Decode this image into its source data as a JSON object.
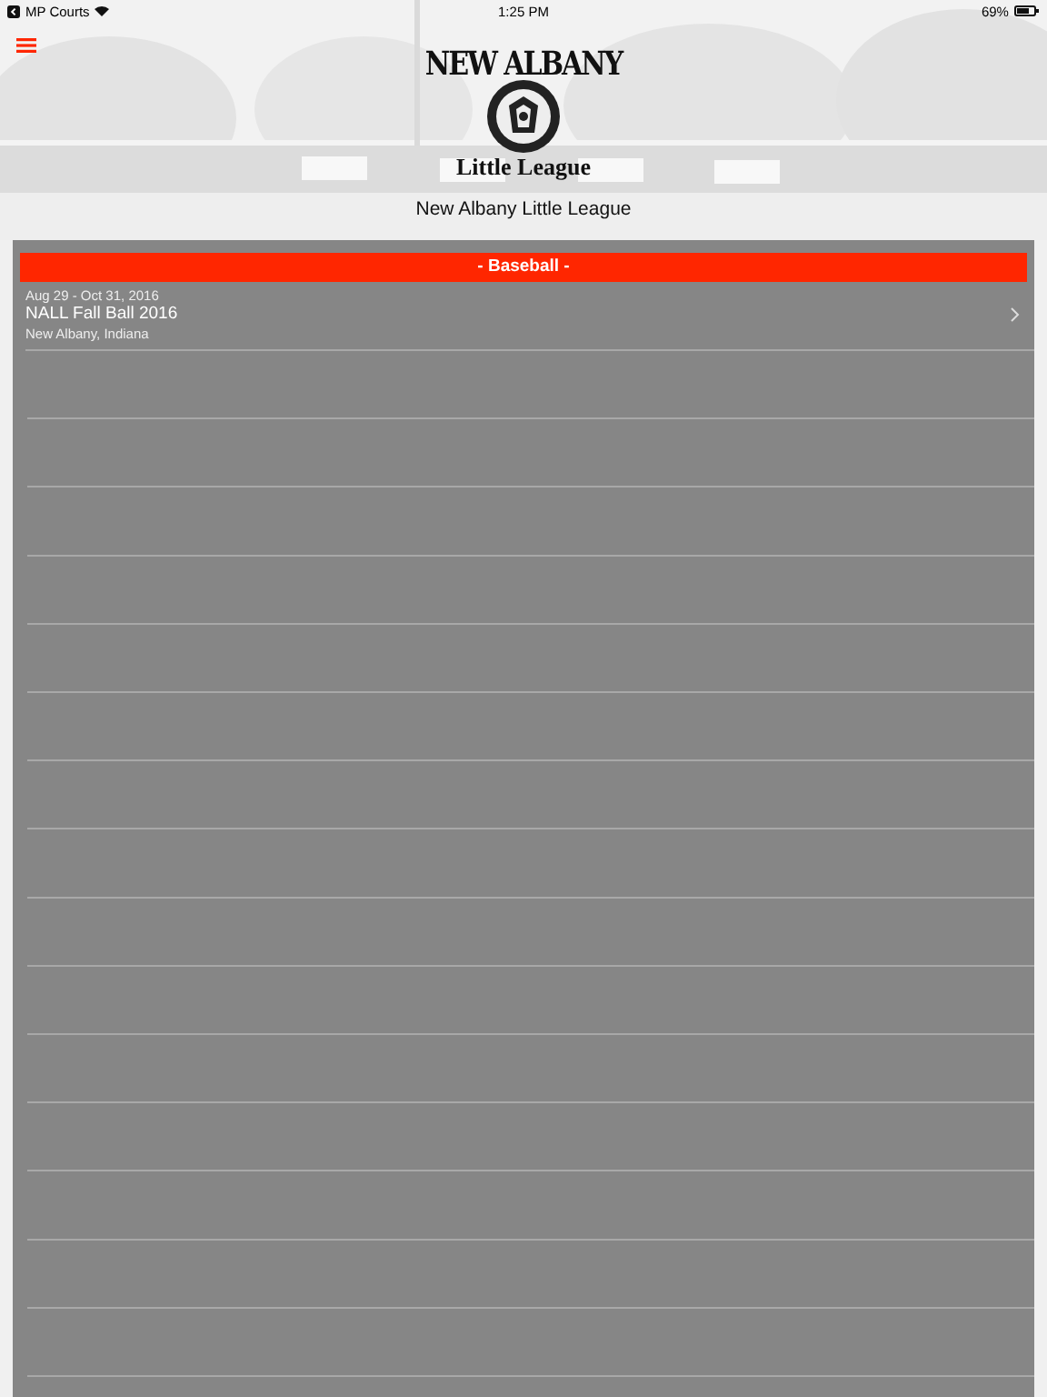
{
  "status_bar": {
    "back_app": "MP Courts",
    "time": "1:25 PM",
    "battery": "69%"
  },
  "header": {
    "logo_top": "NEW ALBANY",
    "logo_bottom": "Little League",
    "title": "New Albany Little League"
  },
  "sections": [
    {
      "label": "- Baseball -",
      "rows": [
        {
          "dates": "Aug 29 - Oct 31, 2016",
          "name": "NALL Fall Ball 2016",
          "location": "New Albany, Indiana"
        }
      ]
    }
  ]
}
